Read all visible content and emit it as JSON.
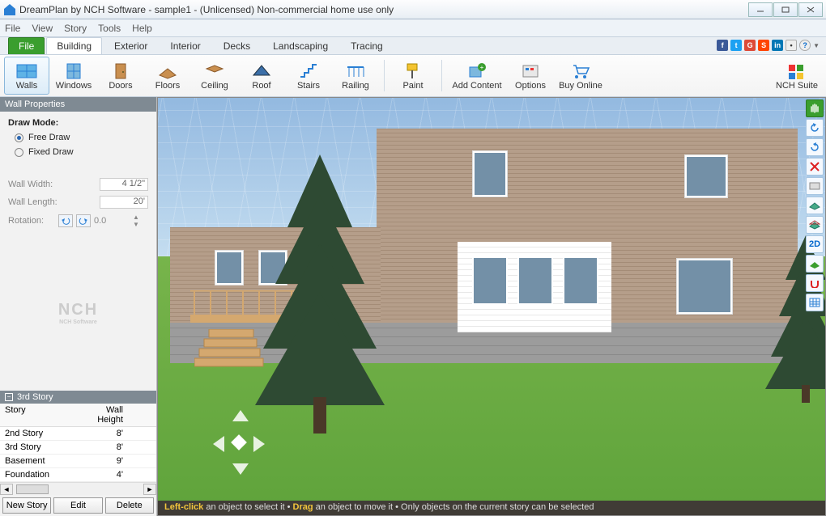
{
  "titlebar": {
    "title": "DreamPlan by NCH Software - sample1 - (Unlicensed) Non-commercial home use only"
  },
  "menu": {
    "file": "File",
    "view": "View",
    "story": "Story",
    "tools": "Tools",
    "help": "Help"
  },
  "tabs": {
    "file": "File",
    "building": "Building",
    "exterior": "Exterior",
    "interior": "Interior",
    "decks": "Decks",
    "landscaping": "Landscaping",
    "tracing": "Tracing"
  },
  "ribbon": {
    "walls": "Walls",
    "windows": "Windows",
    "doors": "Doors",
    "floors": "Floors",
    "ceiling": "Ceiling",
    "roof": "Roof",
    "stairs": "Stairs",
    "railing": "Railing",
    "paint": "Paint",
    "addcontent": "Add Content",
    "options": "Options",
    "buyonline": "Buy Online",
    "nchsuite": "NCH Suite"
  },
  "panel": {
    "title": "Wall Properties",
    "drawmode_label": "Draw Mode:",
    "free_draw": "Free Draw",
    "fixed_draw": "Fixed Draw",
    "wall_width_label": "Wall Width:",
    "wall_width_value": "4 1/2\"",
    "wall_length_label": "Wall Length:",
    "wall_length_value": "20'",
    "rotation_label": "Rotation:",
    "rotation_value": "0.0"
  },
  "logo": {
    "text": "NCH",
    "sub": "NCH Software"
  },
  "story": {
    "header": "3rd Story",
    "col1": "Story",
    "col2": "Wall Height",
    "rows": [
      {
        "name": "2nd Story",
        "h": "8'"
      },
      {
        "name": "3rd Story",
        "h": "8'"
      },
      {
        "name": "Basement",
        "h": "9'"
      },
      {
        "name": "Foundation",
        "h": "4'"
      }
    ],
    "new": "New Story",
    "edit": "Edit",
    "del": "Delete"
  },
  "status": {
    "t1": "Left-click",
    "t2": " an object to select it • ",
    "t3": "Drag",
    "t4": " an object to move it • Only objects on the current story can be selected"
  },
  "righttools": {
    "twod": "2D"
  },
  "colors": {
    "fb": "#3b5998",
    "tw": "#1da1f2",
    "gp": "#dd4b39",
    "su": "#ff4500",
    "in": "#0077b5"
  }
}
